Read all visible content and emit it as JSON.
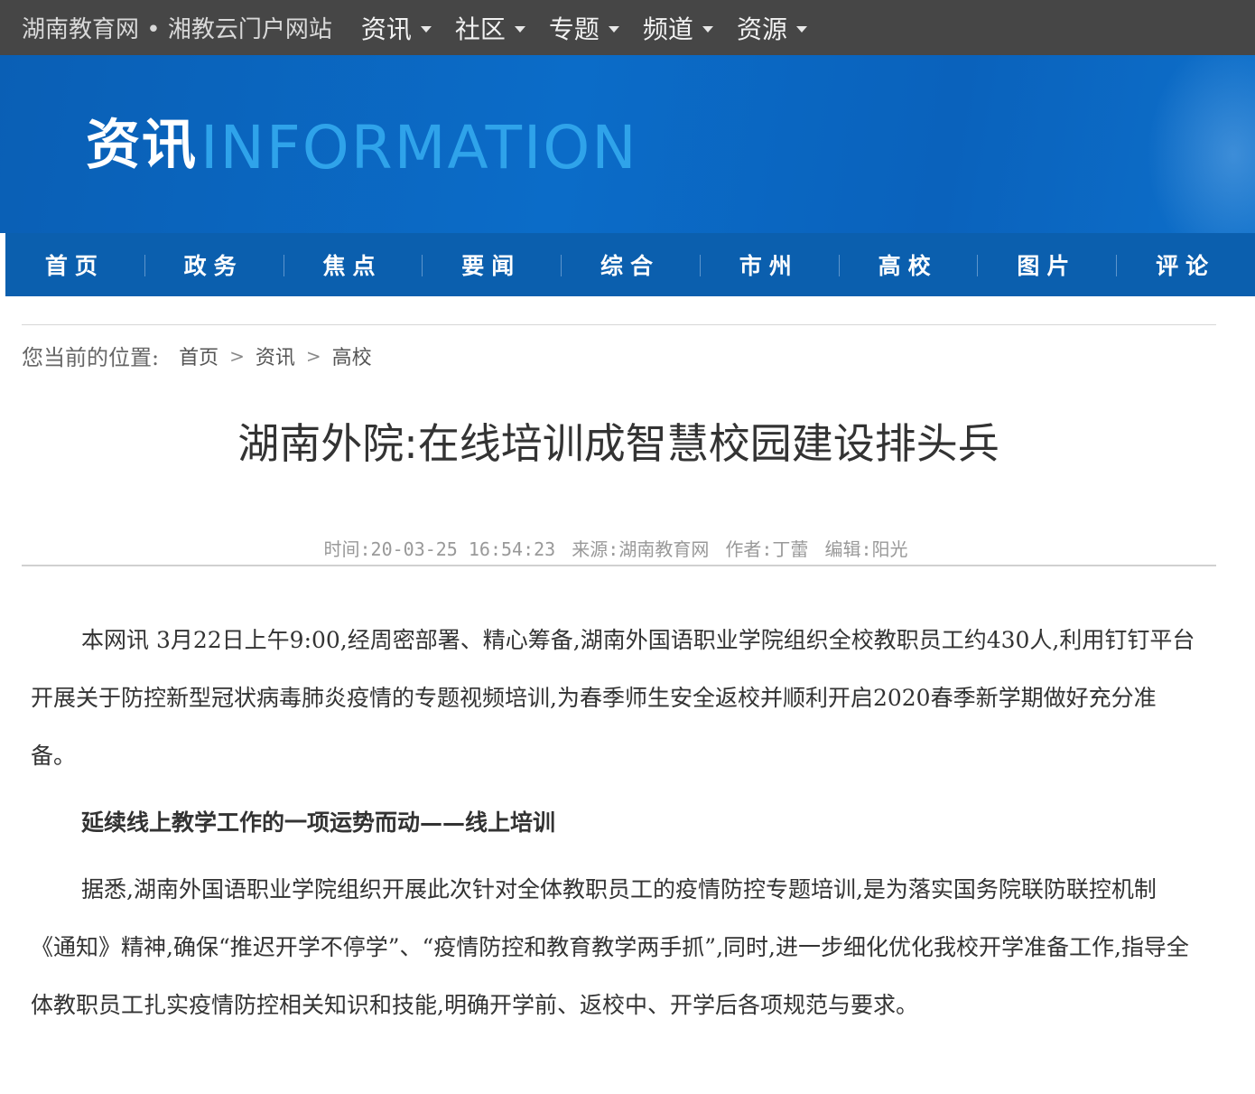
{
  "topbar": {
    "site_title": "湖南教育网 • 湘教云门户网站",
    "nav": [
      {
        "label": "资讯"
      },
      {
        "label": "社区"
      },
      {
        "label": "专题"
      },
      {
        "label": "频道"
      },
      {
        "label": "资源"
      }
    ]
  },
  "banner": {
    "title_cn": "资讯",
    "title_en": "INFORMATION",
    "colors": {
      "background": "#0a62bc",
      "accent_text": "#2fa3ea"
    }
  },
  "main_nav": [
    {
      "label": "首页"
    },
    {
      "label": "政务"
    },
    {
      "label": "焦点"
    },
    {
      "label": "要闻"
    },
    {
      "label": "综合"
    },
    {
      "label": "市州"
    },
    {
      "label": "高校"
    },
    {
      "label": "图片"
    },
    {
      "label": "评论"
    }
  ],
  "breadcrumb": {
    "label": "您当前的位置:",
    "items": [
      "首页",
      "资讯",
      "高校"
    ]
  },
  "article": {
    "title": "湖南外院:在线培训成智慧校园建设排头兵",
    "meta": {
      "time": "时间:20-03-25 16:54:23",
      "source": "来源:湖南教育网",
      "author": "作者:丁蕾",
      "editor": "编辑:阳光"
    },
    "paragraph1": "本网讯 3月22日上午9:00,经周密部署、精心筹备,湖南外国语职业学院组织全校教职员工约430人,利用钉钉平台开展关于防控新型冠状病毒肺炎疫情的专题视频培训,为春季师生安全返校并顺利开启2020春季新学期做好充分准备。",
    "subheading": "延续线上教学工作的一项运势而动——线上培训",
    "paragraph2": "据悉,湖南外国语职业学院组织开展此次针对全体教职员工的疫情防控专题培训,是为落实国务院联防联控机制《通知》精神,确保“推迟开学不停学”、“疫情防控和教育教学两手抓”,同时,进一步细化优化我校开学准备工作,指导全体教职员工扎实疫情防控相关知识和技能,明确开学前、返校中、开学后各项规范与要求。"
  }
}
